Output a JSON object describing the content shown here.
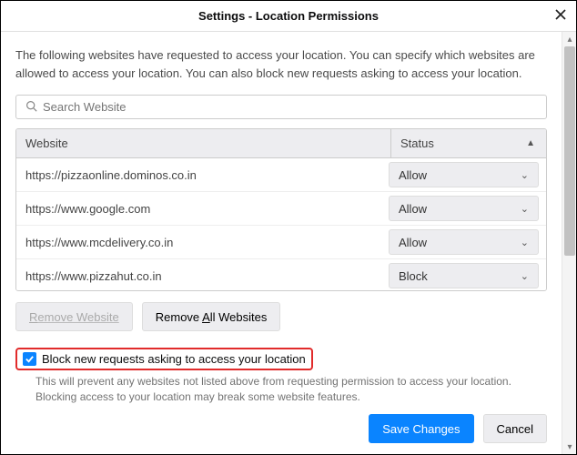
{
  "title": "Settings - Location Permissions",
  "description": "The following websites have requested to access your location. You can specify which websites are allowed to access your location. You can also block new requests asking to access your location.",
  "search_placeholder": "Search Website",
  "headers": {
    "website": "Website",
    "status": "Status"
  },
  "rows": [
    {
      "site": "https://pizzaonline.dominos.co.in",
      "status": "Allow"
    },
    {
      "site": "https://www.google.com",
      "status": "Allow"
    },
    {
      "site": "https://www.mcdelivery.co.in",
      "status": "Allow"
    },
    {
      "site": "https://www.pizzahut.co.in",
      "status": "Block"
    }
  ],
  "buttons": {
    "remove_one": "Remove Website",
    "remove_all": "Remove All Websites",
    "save": "Save Changes",
    "cancel": "Cancel"
  },
  "block_checkbox": {
    "checked": true,
    "label": "Block new requests asking to access your location"
  },
  "hint": "This will prevent any websites not listed above from requesting permission to access your location. Blocking access to your location may break some website features."
}
